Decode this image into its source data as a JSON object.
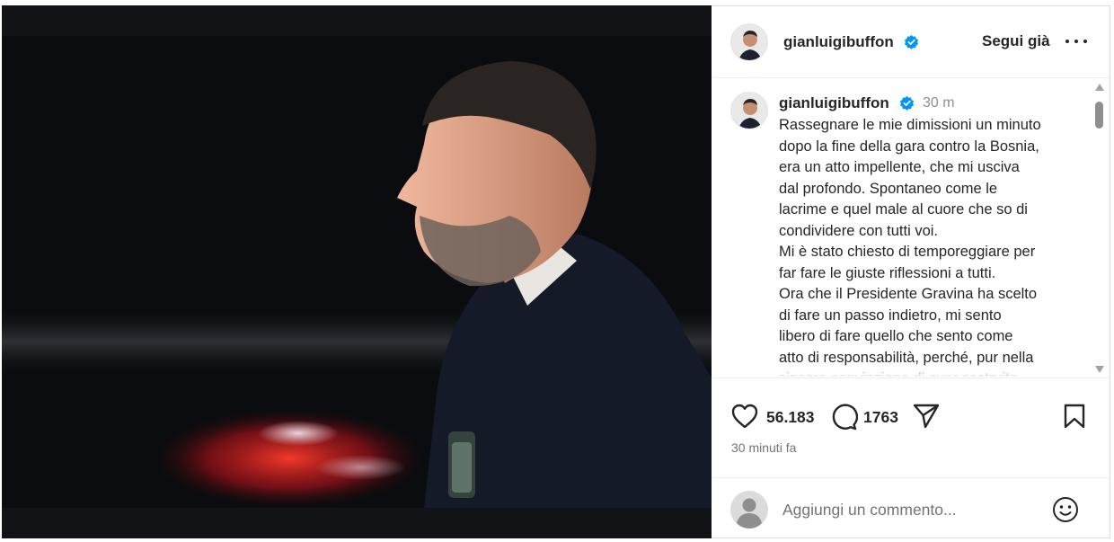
{
  "post": {
    "author": "gianluigibuffon",
    "follow_label": "Segui già",
    "caption_time": "30 m",
    "caption_lines": [
      "Rassegnare le mie dimissioni un minuto",
      "dopo la fine della gara contro la Bosnia,",
      "era un atto impellente, che mi usciva",
      "dal profondo. Spontaneo come le",
      "lacrime e quel male al cuore che so di",
      "condividere con tutti voi.",
      "Mi è stato chiesto di temporeggiare per",
      "far fare le giuste riflessioni a tutti.",
      "Ora che il Presidente Gravina ha scelto",
      "di fare un passo indietro, mi sento",
      "libero di fare quello che sento come",
      "atto di responsabilità, perché, pur nella",
      "sincera convinzione di aver costruito"
    ],
    "likes": "56.183",
    "comments": "1763",
    "timestamp": "30 minuti fa"
  },
  "comment_box": {
    "placeholder": "Aggiungi un commento..."
  },
  "icons": {
    "verified": "verified-badge-icon",
    "more": "more-options-icon",
    "like": "heart-icon",
    "comment": "comment-bubble-icon",
    "share": "paper-plane-icon",
    "save": "bookmark-icon",
    "emoji": "smiley-icon"
  },
  "colors": {
    "verified_blue": "#0095f6",
    "text": "#262626",
    "secondary_text": "#737373",
    "media_background": "#0a0b0e"
  }
}
